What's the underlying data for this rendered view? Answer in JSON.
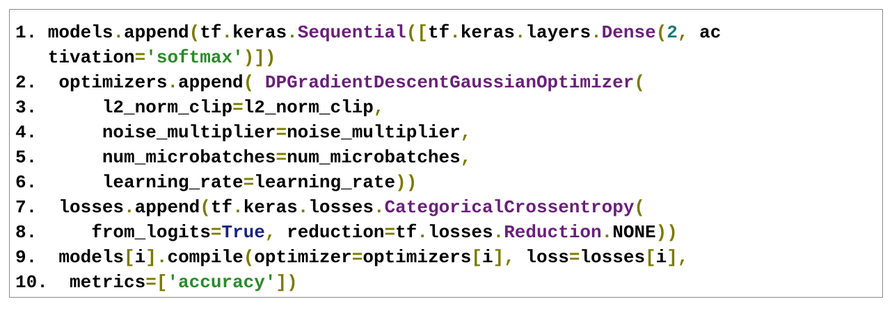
{
  "colors": {
    "plain": "#000000",
    "operator": "#7a7a00",
    "class_or_function": "#6a1f7a",
    "string": "#2b8a2b",
    "number": "#1a7a7a",
    "keyword": "#1a237e",
    "border": "#8a8a8a"
  },
  "code_lines": [
    [
      {
        "t": "1. models",
        "c": "plain"
      },
      {
        "t": ".",
        "c": "op"
      },
      {
        "t": "append",
        "c": "plain"
      },
      {
        "t": "(",
        "c": "op"
      },
      {
        "t": "tf",
        "c": "plain"
      },
      {
        "t": ".",
        "c": "op"
      },
      {
        "t": "keras",
        "c": "plain"
      },
      {
        "t": ".",
        "c": "op"
      },
      {
        "t": "Sequential",
        "c": "cls"
      },
      {
        "t": "([",
        "c": "op"
      },
      {
        "t": "tf",
        "c": "plain"
      },
      {
        "t": ".",
        "c": "op"
      },
      {
        "t": "keras",
        "c": "plain"
      },
      {
        "t": ".",
        "c": "op"
      },
      {
        "t": "layers",
        "c": "plain"
      },
      {
        "t": ".",
        "c": "op"
      },
      {
        "t": "Dense",
        "c": "cls"
      },
      {
        "t": "(",
        "c": "op"
      },
      {
        "t": "2",
        "c": "num"
      },
      {
        "t": ",",
        "c": "op"
      },
      {
        "t": " ac",
        "c": "plain"
      }
    ],
    [
      {
        "t": "   tivation",
        "c": "plain"
      },
      {
        "t": "=",
        "c": "op"
      },
      {
        "t": "'softmax'",
        "c": "str"
      },
      {
        "t": ")])",
        "c": "op"
      }
    ],
    [
      {
        "t": "2.  optimizers",
        "c": "plain"
      },
      {
        "t": ".",
        "c": "op"
      },
      {
        "t": "append",
        "c": "plain"
      },
      {
        "t": "(",
        "c": "op"
      },
      {
        "t": " ",
        "c": "plain"
      },
      {
        "t": "DPGradientDescentGaussianOptimizer",
        "c": "cls"
      },
      {
        "t": "(",
        "c": "op"
      }
    ],
    [
      {
        "t": "3.      l2_norm_clip",
        "c": "plain"
      },
      {
        "t": "=",
        "c": "op"
      },
      {
        "t": "l2_norm_clip",
        "c": "plain"
      },
      {
        "t": ",",
        "c": "op"
      }
    ],
    [
      {
        "t": "4.      noise_multiplier",
        "c": "plain"
      },
      {
        "t": "=",
        "c": "op"
      },
      {
        "t": "noise_multiplier",
        "c": "plain"
      },
      {
        "t": ",",
        "c": "op"
      }
    ],
    [
      {
        "t": "5.      num_microbatches",
        "c": "plain"
      },
      {
        "t": "=",
        "c": "op"
      },
      {
        "t": "num_microbatches",
        "c": "plain"
      },
      {
        "t": ",",
        "c": "op"
      }
    ],
    [
      {
        "t": "6.      learning_rate",
        "c": "plain"
      },
      {
        "t": "=",
        "c": "op"
      },
      {
        "t": "learning_rate",
        "c": "plain"
      },
      {
        "t": "))",
        "c": "op"
      }
    ],
    [
      {
        "t": "7.  losses",
        "c": "plain"
      },
      {
        "t": ".",
        "c": "op"
      },
      {
        "t": "append",
        "c": "plain"
      },
      {
        "t": "(",
        "c": "op"
      },
      {
        "t": "tf",
        "c": "plain"
      },
      {
        "t": ".",
        "c": "op"
      },
      {
        "t": "keras",
        "c": "plain"
      },
      {
        "t": ".",
        "c": "op"
      },
      {
        "t": "losses",
        "c": "plain"
      },
      {
        "t": ".",
        "c": "op"
      },
      {
        "t": "CategoricalCrossentropy",
        "c": "cls"
      },
      {
        "t": "(",
        "c": "op"
      }
    ],
    [
      {
        "t": "8.     from_logits",
        "c": "plain"
      },
      {
        "t": "=",
        "c": "op"
      },
      {
        "t": "True",
        "c": "kw"
      },
      {
        "t": ",",
        "c": "op"
      },
      {
        "t": " reduction",
        "c": "plain"
      },
      {
        "t": "=",
        "c": "op"
      },
      {
        "t": "tf",
        "c": "plain"
      },
      {
        "t": ".",
        "c": "op"
      },
      {
        "t": "losses",
        "c": "plain"
      },
      {
        "t": ".",
        "c": "op"
      },
      {
        "t": "Reduction",
        "c": "cls"
      },
      {
        "t": ".",
        "c": "op"
      },
      {
        "t": "NONE",
        "c": "plain"
      },
      {
        "t": "))",
        "c": "op"
      }
    ],
    [
      {
        "t": "9.  models",
        "c": "plain"
      },
      {
        "t": "[",
        "c": "op"
      },
      {
        "t": "i",
        "c": "plain"
      },
      {
        "t": "].",
        "c": "op"
      },
      {
        "t": "compile",
        "c": "plain"
      },
      {
        "t": "(",
        "c": "op"
      },
      {
        "t": "optimizer",
        "c": "plain"
      },
      {
        "t": "=",
        "c": "op"
      },
      {
        "t": "optimizers",
        "c": "plain"
      },
      {
        "t": "[",
        "c": "op"
      },
      {
        "t": "i",
        "c": "plain"
      },
      {
        "t": "],",
        "c": "op"
      },
      {
        "t": " loss",
        "c": "plain"
      },
      {
        "t": "=",
        "c": "op"
      },
      {
        "t": "losses",
        "c": "plain"
      },
      {
        "t": "[",
        "c": "op"
      },
      {
        "t": "i",
        "c": "plain"
      },
      {
        "t": "],",
        "c": "op"
      }
    ],
    [
      {
        "t": "10.  metrics",
        "c": "plain"
      },
      {
        "t": "=[",
        "c": "op"
      },
      {
        "t": "'accuracy'",
        "c": "str"
      },
      {
        "t": "])",
        "c": "op"
      }
    ]
  ]
}
